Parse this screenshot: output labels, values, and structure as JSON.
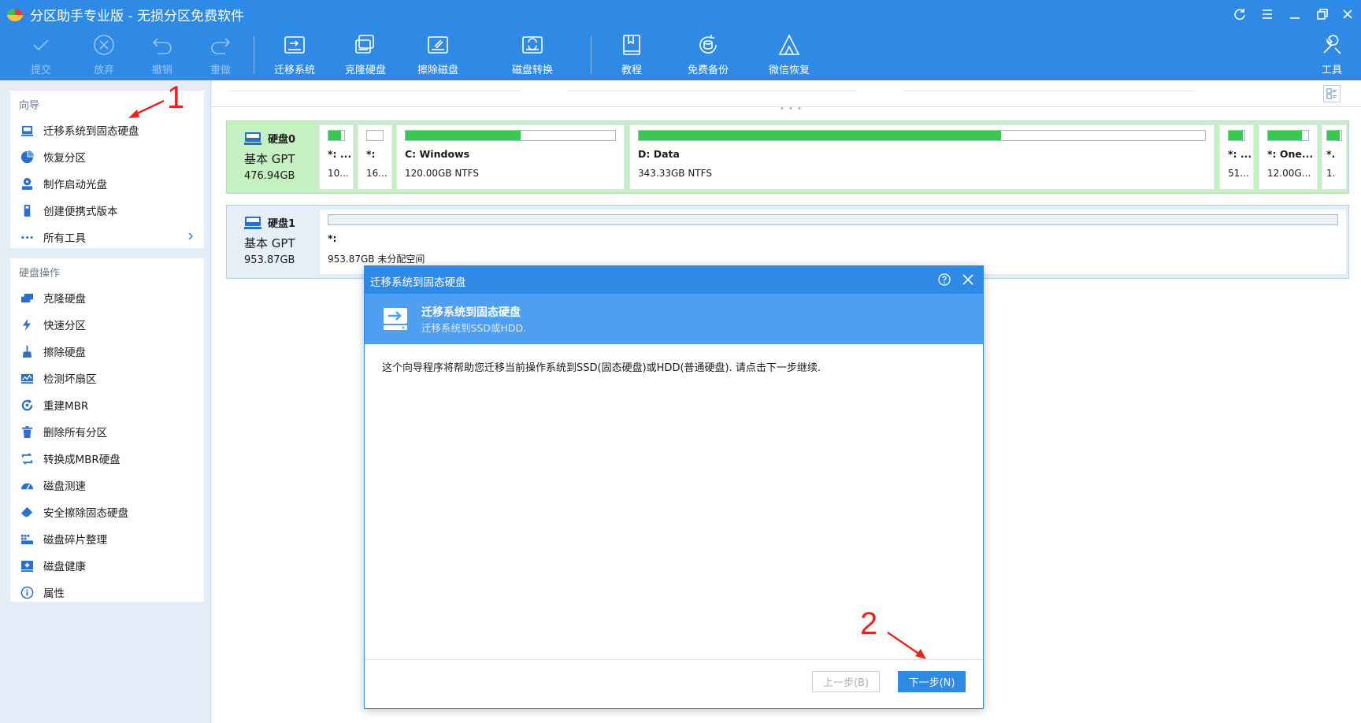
{
  "window": {
    "title": "分区助手专业版 - 无损分区免费软件",
    "accent_color": "#2f8ae6",
    "controls": [
      "refresh-icon",
      "menu-icon",
      "minimize-icon",
      "restore-icon",
      "close-icon"
    ]
  },
  "toolbar": {
    "items": [
      {
        "label": "提交",
        "icon": "check-icon",
        "enabled": false
      },
      {
        "label": "放弃",
        "icon": "discard-icon",
        "enabled": false
      },
      {
        "label": "撤销",
        "icon": "undo-icon",
        "enabled": false
      },
      {
        "label": "重做",
        "icon": "redo-icon",
        "enabled": false
      },
      {
        "label": "迁移系统",
        "icon": "migrate-os-icon",
        "enabled": true
      },
      {
        "label": "克隆硬盘",
        "icon": "clone-disk-icon",
        "enabled": true
      },
      {
        "label": "擦除磁盘",
        "icon": "wipe-disk-icon",
        "enabled": true
      },
      {
        "label": "磁盘转换",
        "icon": "convert-disk-icon",
        "enabled": true
      },
      {
        "label": "教程",
        "icon": "tutorial-icon",
        "enabled": true
      },
      {
        "label": "免费备份",
        "icon": "backup-icon",
        "enabled": true
      },
      {
        "label": "微信恢复",
        "icon": "recovery-icon",
        "enabled": true
      },
      {
        "label": "工具",
        "icon": "tools-icon",
        "enabled": true
      }
    ]
  },
  "sidebar": {
    "wizard_title": "向导",
    "wizard_items": [
      {
        "label": "迁移系统到固态硬盘",
        "icon": "migrate-ssd-icon"
      },
      {
        "label": "恢复分区",
        "icon": "recover-partition-icon"
      },
      {
        "label": "制作启动光盘",
        "icon": "bootable-media-icon"
      },
      {
        "label": "创建便携式版本",
        "icon": "portable-version-icon"
      },
      {
        "label": "所有工具",
        "icon": "more-icon"
      }
    ],
    "disk_ops_title": "硬盘操作",
    "disk_ops_items": [
      {
        "label": "克隆硬盘",
        "icon": "clone-disk-icon"
      },
      {
        "label": "快速分区",
        "icon": "quick-partition-icon"
      },
      {
        "label": "擦除硬盘",
        "icon": "wipe-disk-icon"
      },
      {
        "label": "检测坏扇区",
        "icon": "bad-sector-icon"
      },
      {
        "label": "重建MBR",
        "icon": "rebuild-mbr-icon"
      },
      {
        "label": "删除所有分区",
        "icon": "delete-all-icon"
      },
      {
        "label": "转换成MBR硬盘",
        "icon": "convert-mbr-icon"
      },
      {
        "label": "磁盘测速",
        "icon": "speed-test-icon"
      },
      {
        "label": "安全擦除固态硬盘",
        "icon": "secure-erase-icon"
      },
      {
        "label": "磁盘碎片整理",
        "icon": "defrag-icon"
      },
      {
        "label": "磁盘健康",
        "icon": "disk-health-icon"
      },
      {
        "label": "属性",
        "icon": "info-icon"
      }
    ]
  },
  "disks": [
    {
      "name": "硬盘0",
      "type": "基本 GPT",
      "size": "476.94GB",
      "partitions": [
        {
          "name": "*: ...",
          "size": "10...",
          "used": 0.8
        },
        {
          "name": "*:",
          "size": "16...",
          "used": 0.0
        },
        {
          "name": "C: Windows",
          "size": "120.00GB NTFS",
          "used": 0.55
        },
        {
          "name": "D: Data",
          "size": "343.33GB NTFS",
          "used": 0.64
        },
        {
          "name": "*: ...",
          "size": "51...",
          "used": 0.9
        },
        {
          "name": "*: One...",
          "size": "12.00G...",
          "used": 0.85
        },
        {
          "name": "*.",
          "size": "1.",
          "used": 0.9
        }
      ]
    },
    {
      "name": "硬盘1",
      "type": "基本 GPT",
      "size": "953.87GB",
      "partitions": [
        {
          "name": "*:",
          "size": "953.87GB 未分配空间",
          "used": 0.0
        }
      ]
    }
  ],
  "dialog": {
    "title": "迁移系统到固态硬盘",
    "banner_title": "迁移系统到固态硬盘",
    "banner_subtitle": "迁移系统到SSD或HDD.",
    "body": "这个向导程序将帮助您迁移当前操作系统到SSD(固态硬盘)或HDD(普通硬盘). 请点击下一步继续.",
    "prev_button": "上一步(B)",
    "next_button": "下一步(N)"
  },
  "annotations": {
    "step1": "1",
    "step2": "2",
    "color": "#e8241d"
  }
}
